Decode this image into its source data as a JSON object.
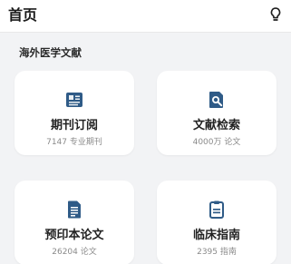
{
  "header": {
    "title": "首页",
    "icon": "lightbulb-icon"
  },
  "section": {
    "title": "海外医学文献"
  },
  "colors": {
    "accent": "#2f5b87",
    "background": "#f2f3f5",
    "card": "#ffffff"
  },
  "cards": [
    {
      "icon": "newspaper-icon",
      "title": "期刊订阅",
      "subtitle": "7147 专业期刊"
    },
    {
      "icon": "search-document-icon",
      "title": "文献检索",
      "subtitle": "4000万 论文"
    },
    {
      "icon": "document-icon",
      "title": "预印本论文",
      "subtitle": "26204 论文"
    },
    {
      "icon": "clipboard-icon",
      "title": "临床指南",
      "subtitle": "2395 指南"
    }
  ]
}
